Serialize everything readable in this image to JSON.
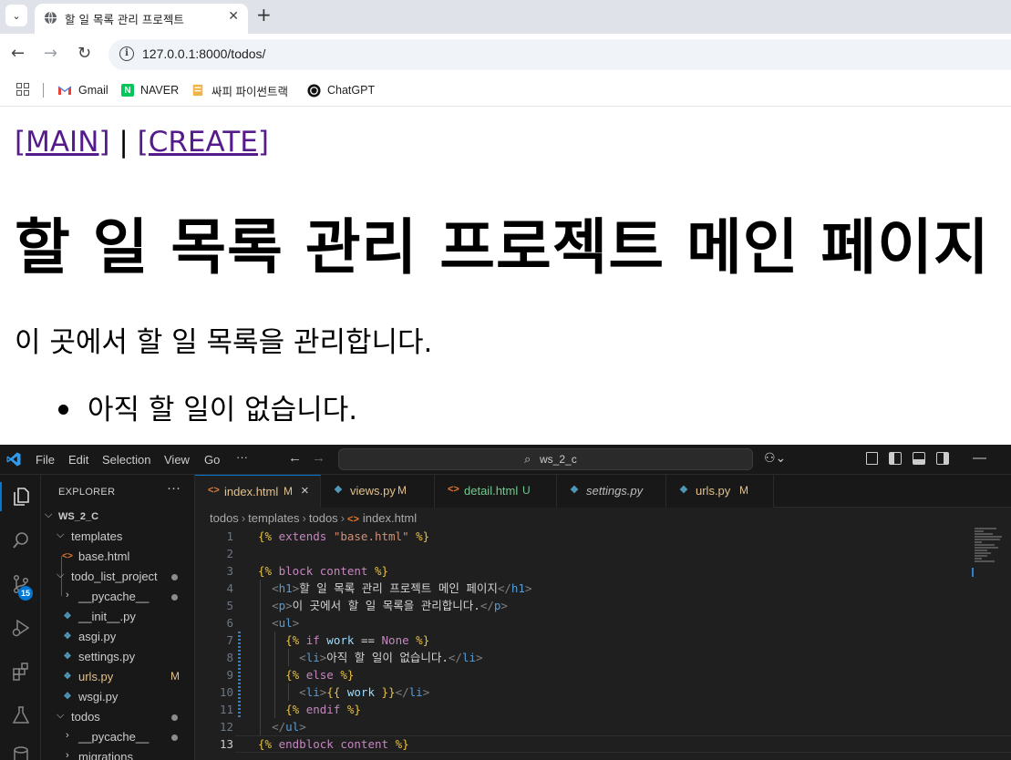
{
  "browser": {
    "tab_title": "할 일 목록 관리 프로젝트",
    "url": "127.0.0.1:8000/todos/",
    "bookmarks": [
      {
        "label": "Gmail",
        "icon": "gmail-icon"
      },
      {
        "label": "NAVER",
        "icon": "naver-icon"
      },
      {
        "label": "싸피 파이썬트랙",
        "icon": "folder-icon"
      },
      {
        "label": "ChatGPT",
        "icon": "chatgpt-icon"
      }
    ]
  },
  "page": {
    "main_link": "[MAIN]",
    "separator": "|",
    "create_link": "[CREATE]",
    "heading": "할 일 목록 관리 프로젝트 메인 페이지",
    "description": "이 곳에서 할 일 목록을 관리합니다.",
    "items": [
      "아직 할 일이 없습니다."
    ]
  },
  "vscode": {
    "menu": [
      "File",
      "Edit",
      "Selection",
      "View",
      "Go",
      "···"
    ],
    "search_text": "ws_2_c",
    "explorer_title": "EXPLORER",
    "explorer_more": "···",
    "scm_badge": "15",
    "tree": [
      {
        "label": "WS_2_C",
        "level": 0,
        "type": "folder-open",
        "status": ""
      },
      {
        "label": "templates",
        "level": 1,
        "type": "folder-open",
        "status": ""
      },
      {
        "label": "base.html",
        "level": 2,
        "type": "html",
        "status": ""
      },
      {
        "label": "todo_list_project",
        "level": 1,
        "type": "folder-open",
        "status": "dot"
      },
      {
        "label": "__pycache__",
        "level": 2,
        "type": "folder",
        "status": "dot"
      },
      {
        "label": "__init__.py",
        "level": 2,
        "type": "py",
        "status": ""
      },
      {
        "label": "asgi.py",
        "level": 2,
        "type": "py",
        "status": ""
      },
      {
        "label": "settings.py",
        "level": 2,
        "type": "py",
        "status": ""
      },
      {
        "label": "urls.py",
        "level": 2,
        "type": "py",
        "status": "M"
      },
      {
        "label": "wsgi.py",
        "level": 2,
        "type": "py",
        "status": ""
      },
      {
        "label": "todos",
        "level": 1,
        "type": "folder-open",
        "status": "dot"
      },
      {
        "label": "__pycache__",
        "level": 2,
        "type": "folder",
        "status": "dot"
      },
      {
        "label": "migrations",
        "level": 2,
        "type": "folder",
        "status": ""
      }
    ],
    "tabs": [
      {
        "label": "index.html",
        "status": "M",
        "icon": "html",
        "active": true,
        "italic": false,
        "close": "×"
      },
      {
        "label": "views.py",
        "status": "M",
        "icon": "py",
        "active": false,
        "italic": false,
        "close": ""
      },
      {
        "label": "detail.html",
        "status": "U",
        "icon": "html",
        "active": false,
        "italic": false,
        "close": ""
      },
      {
        "label": "settings.py",
        "status": "",
        "icon": "py",
        "active": false,
        "italic": true,
        "close": ""
      },
      {
        "label": "urls.py",
        "status": "M",
        "icon": "py",
        "active": false,
        "italic": false,
        "close": ""
      }
    ],
    "breadcrumb": [
      "todos",
      "templates",
      "todos",
      "index.html"
    ],
    "code_lines": [
      "{% extends \"base.html\" %}",
      "",
      "{% block content %}",
      "  <h1>할 일 목록 관리 프로젝트 메인 페이지</h1>",
      "  <p>이 곳에서 할 일 목록을 관리합니다.</p>",
      "  <ul>",
      "    {% if work == None %}",
      "      <li>아직 할 일이 없습니다.</li>",
      "    {% else %}",
      "      <li>{{ work }}</li>",
      "    {% endif %}",
      "  </ul>",
      "{% endblock content %}"
    ],
    "current_line": 13
  }
}
